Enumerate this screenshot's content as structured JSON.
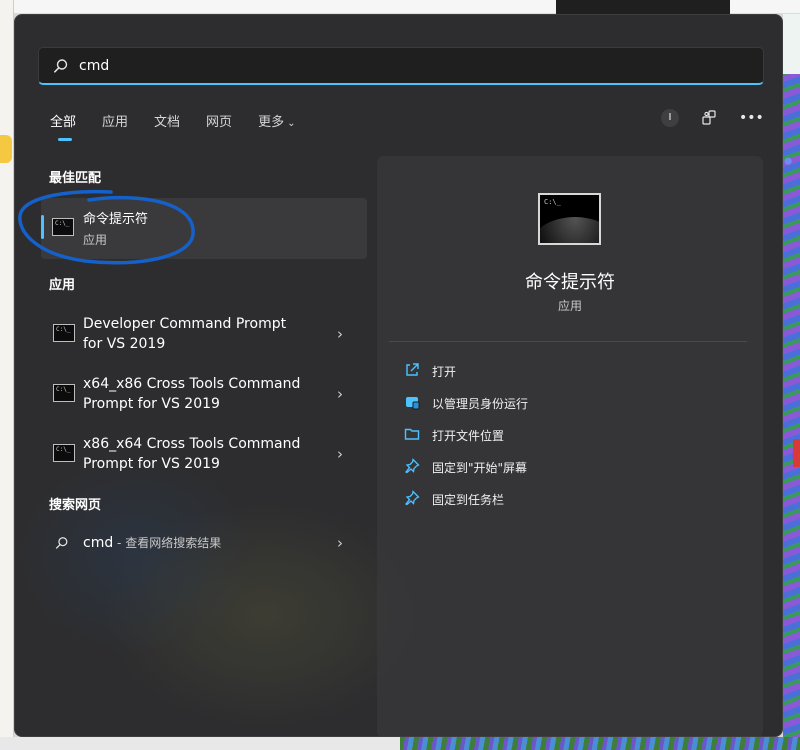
{
  "search": {
    "query": "cmd"
  },
  "tabs": [
    {
      "label": "全部"
    },
    {
      "label": "应用"
    },
    {
      "label": "文档"
    },
    {
      "label": "网页"
    },
    {
      "label": "更多"
    }
  ],
  "top_right": {
    "badge": "I"
  },
  "sections": {
    "best_match": "最佳匹配",
    "apps": "应用",
    "web": "搜索网页"
  },
  "best_match": {
    "title": "命令提示符",
    "subtitle": "应用"
  },
  "apps": [
    {
      "line1": "Developer Command Prompt",
      "line2": "for VS 2019"
    },
    {
      "line1": "x64_x86 Cross Tools Command",
      "line2": "Prompt for VS 2019"
    },
    {
      "line1": "x86_x64 Cross Tools Command",
      "line2": "Prompt for VS 2019"
    }
  ],
  "web": {
    "query": "cmd",
    "hint": " - 查看网络搜索结果"
  },
  "preview": {
    "title": "命令提示符",
    "subtitle": "应用",
    "actions": [
      {
        "label": "打开",
        "icon": "open-icon"
      },
      {
        "label": "以管理员身份运行",
        "icon": "shield-icon"
      },
      {
        "label": "打开文件位置",
        "icon": "folder-icon"
      },
      {
        "label": "固定到\"开始\"屏幕",
        "icon": "pin-icon"
      },
      {
        "label": "固定到任务栏",
        "icon": "pin-icon"
      }
    ]
  },
  "colors": {
    "accent": "#4cc2ff",
    "panel": "#2d2d2f",
    "annotation": "#1560c9"
  }
}
